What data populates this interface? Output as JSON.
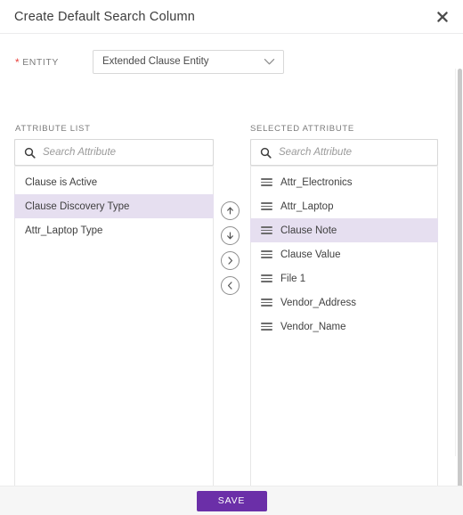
{
  "header": {
    "title": "Create Default Search Column",
    "close_icon": "close-icon"
  },
  "form": {
    "entity_label": "ENTITY",
    "entity_required_marker": "*",
    "entity_value": "Extended Clause Entity",
    "entity_chevron_icon": "chevron-down-icon"
  },
  "attribute_list": {
    "heading": "ATTRIBUTE LIST",
    "search_placeholder": "Search Attribute",
    "search_value": "",
    "search_icon": "search-icon",
    "items": [
      {
        "label": "Clause is Active",
        "selected": false
      },
      {
        "label": "Clause Discovery Type",
        "selected": true
      },
      {
        "label": "Attr_Laptop Type",
        "selected": false
      }
    ]
  },
  "selected_attribute": {
    "heading": "SELECTED ATTRIBUTE",
    "search_placeholder": "Search Attribute",
    "search_value": "",
    "search_icon": "search-icon",
    "items": [
      {
        "label": "Attr_Electronics",
        "selected": false
      },
      {
        "label": "Attr_Laptop",
        "selected": false
      },
      {
        "label": "Clause Note",
        "selected": true
      },
      {
        "label": "Clause Value",
        "selected": false
      },
      {
        "label": "File 1",
        "selected": false
      },
      {
        "label": "Vendor_Address",
        "selected": false
      },
      {
        "label": "Vendor_Name",
        "selected": false
      }
    ]
  },
  "transfer_buttons": [
    {
      "name": "move-up-button",
      "icon": "arrow-up-icon"
    },
    {
      "name": "move-down-button",
      "icon": "arrow-down-icon"
    },
    {
      "name": "move-right-button",
      "icon": "chevron-right-icon"
    },
    {
      "name": "move-left-button",
      "icon": "chevron-left-icon"
    }
  ],
  "footer": {
    "save_label": "SAVE"
  },
  "colors": {
    "accent_purple": "#6b2fa8",
    "row_highlight": "#e6dff0",
    "required_red": "#e8413c",
    "text_primary": "#3c3c3c",
    "text_muted": "#7b7b7b",
    "footer_bg": "#f6f6f6"
  }
}
